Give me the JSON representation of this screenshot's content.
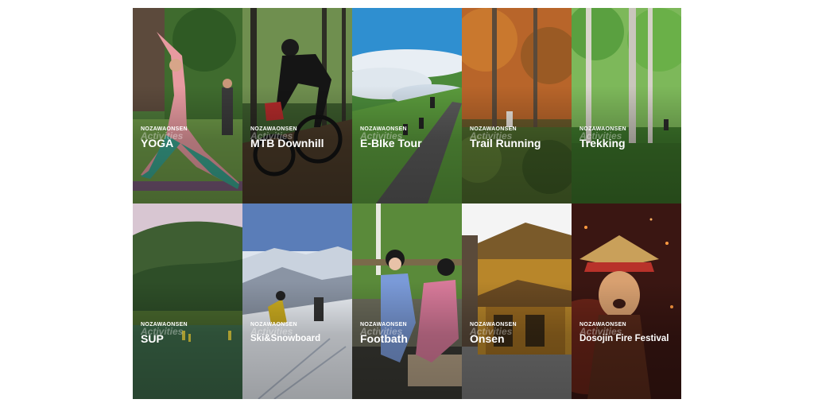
{
  "brand": "NOZAWAONSEN",
  "subtitle": "Activities",
  "tiles": [
    {
      "title": "YOGA"
    },
    {
      "title": "MTB Downhill"
    },
    {
      "title": "E-BIke Tour"
    },
    {
      "title": "Trail Running"
    },
    {
      "title": "Trekking"
    },
    {
      "title": "SUP"
    },
    {
      "title": "Ski&Snowboard"
    },
    {
      "title": "Footbath"
    },
    {
      "title": "Onsen"
    },
    {
      "title": "Dosojin Fire Festival"
    }
  ]
}
